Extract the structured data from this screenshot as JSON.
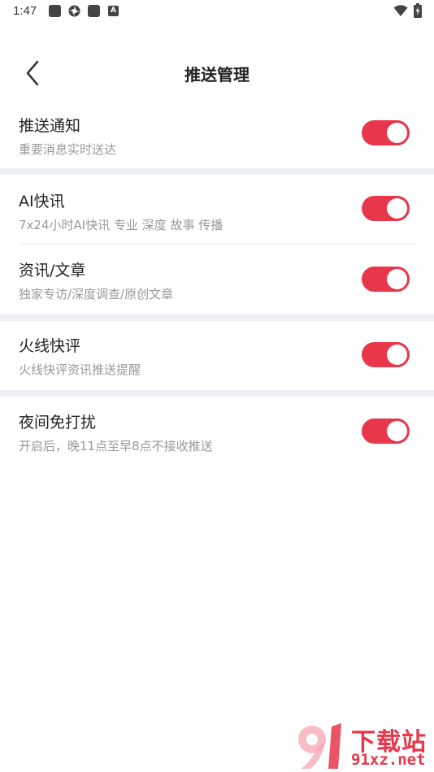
{
  "status_bar": {
    "time": "1:47",
    "icons": [
      "app-square-icon",
      "pinwheel-icon",
      "app-square-icon",
      "a-badge-icon"
    ],
    "a_badge": "A",
    "right_icons": [
      "wifi-icon",
      "battery-charging-icon"
    ]
  },
  "header": {
    "title": "推送管理",
    "back_icon": "chevron-left-icon"
  },
  "settings": [
    {
      "title": "推送通知",
      "subtitle": "重要消息实时送达",
      "enabled": true
    },
    {
      "title": "AI快讯",
      "subtitle": "7x24小时AI快讯 专业 深度 故事 传播",
      "enabled": true
    },
    {
      "title": "资讯/文章",
      "subtitle": "独家专访/深度调查/原创文章",
      "enabled": true
    },
    {
      "title": "火线快评",
      "subtitle": "火线快评资讯推送提醒",
      "enabled": true
    },
    {
      "title": "夜间免打扰",
      "subtitle": "开启后，晚11点至早8点不接收推送",
      "enabled": true
    }
  ],
  "colors": {
    "accent": "#e8364a",
    "section_gap": "#eef0f4",
    "subtitle": "#999999"
  },
  "watermark": {
    "text_cn": "下载站",
    "text_url": "91xz.net"
  }
}
